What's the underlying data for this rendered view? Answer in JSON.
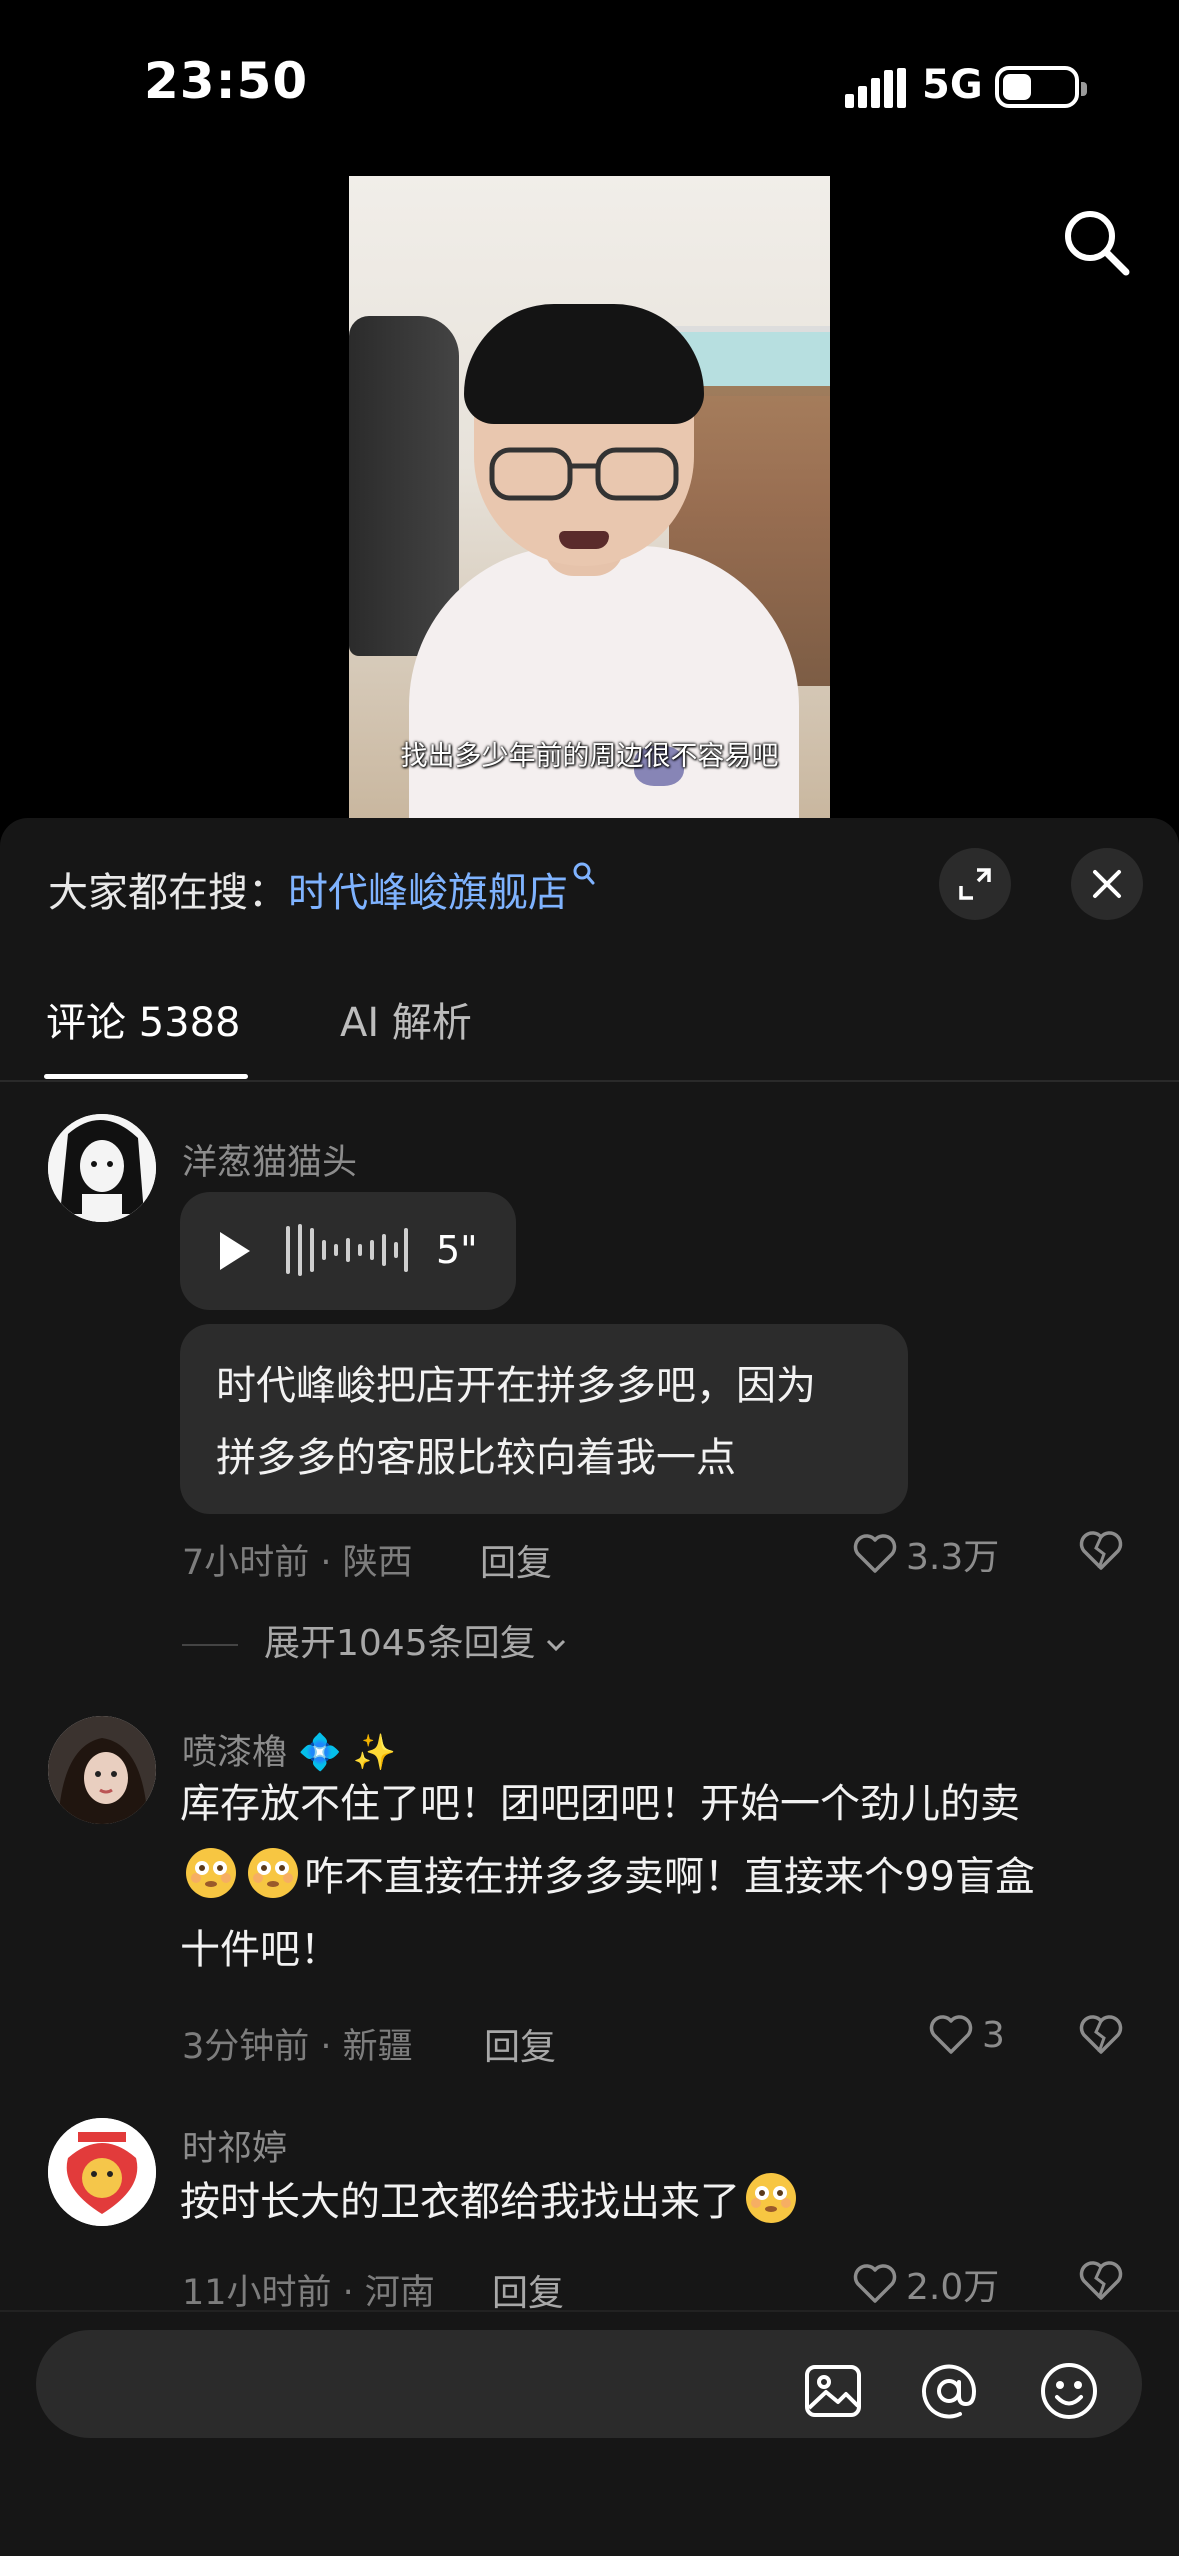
{
  "status_bar": {
    "time": "23:50",
    "network": "5G"
  },
  "video": {
    "caption": "找出多少年前的周边很不容易吧"
  },
  "sheet": {
    "trending_prefix": "大家都在搜：",
    "trending_link": "时代峰峻旗舰店"
  },
  "tabs": {
    "comments": "评论 5388",
    "ai": "AI 解析"
  },
  "comments": [
    {
      "username": "洋葱猫猫头",
      "voice_duration": "5\"",
      "text_line1": "时代峰峻把店开在拼多多吧，因为",
      "text_line2": "拼多多的客服比较向着我一点",
      "time_location": "7小时前 · 陕西",
      "reply": "回复",
      "likes": "3.3万",
      "expand": "展开1045条回复"
    },
    {
      "username": "喷漆櫓",
      "username_decor": "💠 ✨",
      "text_line1": "库存放不住了吧！团吧团吧！开始一个劲儿的卖",
      "text_line2_after_emoji": "咋不直接在拼多多卖啊！直接来个99盲盒",
      "text_line3": "十件吧！",
      "time_location": "3分钟前 · 新疆",
      "reply": "回复",
      "likes": "3"
    },
    {
      "username": "时祁婷",
      "text": "按时长大的卫衣都给我找出来了",
      "time_location": "11小时前 · 河南",
      "reply": "回复",
      "likes": "2.0万"
    }
  ],
  "input_bar": {
    "placeholder": ""
  },
  "icons": [
    "search-icon",
    "expand-icon",
    "close-icon",
    "play-icon",
    "heart-icon",
    "broken-heart-icon",
    "image-icon",
    "at-icon",
    "emoji-icon",
    "chevron-down-icon"
  ],
  "colors": {
    "accent_link": "#7fb3ff",
    "sheet_bg": "#161616",
    "bubble_bg": "#2c2c2c"
  }
}
